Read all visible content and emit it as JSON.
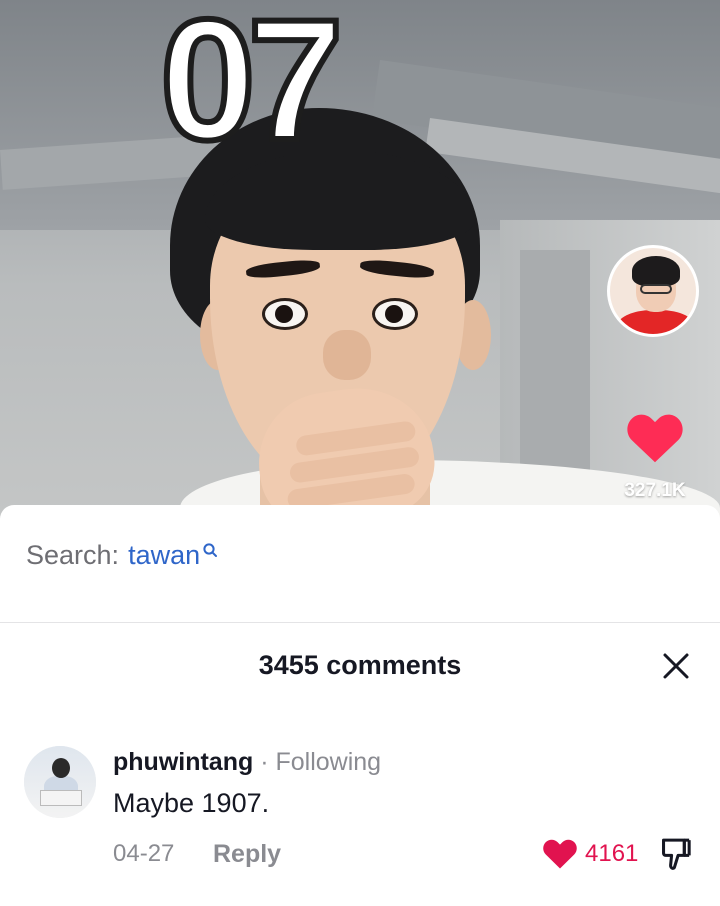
{
  "video": {
    "overlay_number": "07",
    "like_count": "327.1K",
    "colors": {
      "like": "#fe2c55"
    },
    "icons": [
      "creator-avatar",
      "heart-icon"
    ]
  },
  "search": {
    "prefix": "Search:",
    "term": "tawan",
    "icon": "search-icon"
  },
  "comments": {
    "title": "3455 comments",
    "close_icon": "close-icon",
    "items": [
      {
        "username": "phuwintang",
        "relation": "· Following",
        "text": "Maybe 1907.",
        "date": "04-27",
        "reply_label": "Reply",
        "like_count": "4161",
        "icons": [
          "heart-icon",
          "dislike-icon"
        ]
      }
    ]
  },
  "colors": {
    "accent_blue": "#2f66c9",
    "like_red": "#e1134f",
    "muted": "#8a8b91"
  }
}
